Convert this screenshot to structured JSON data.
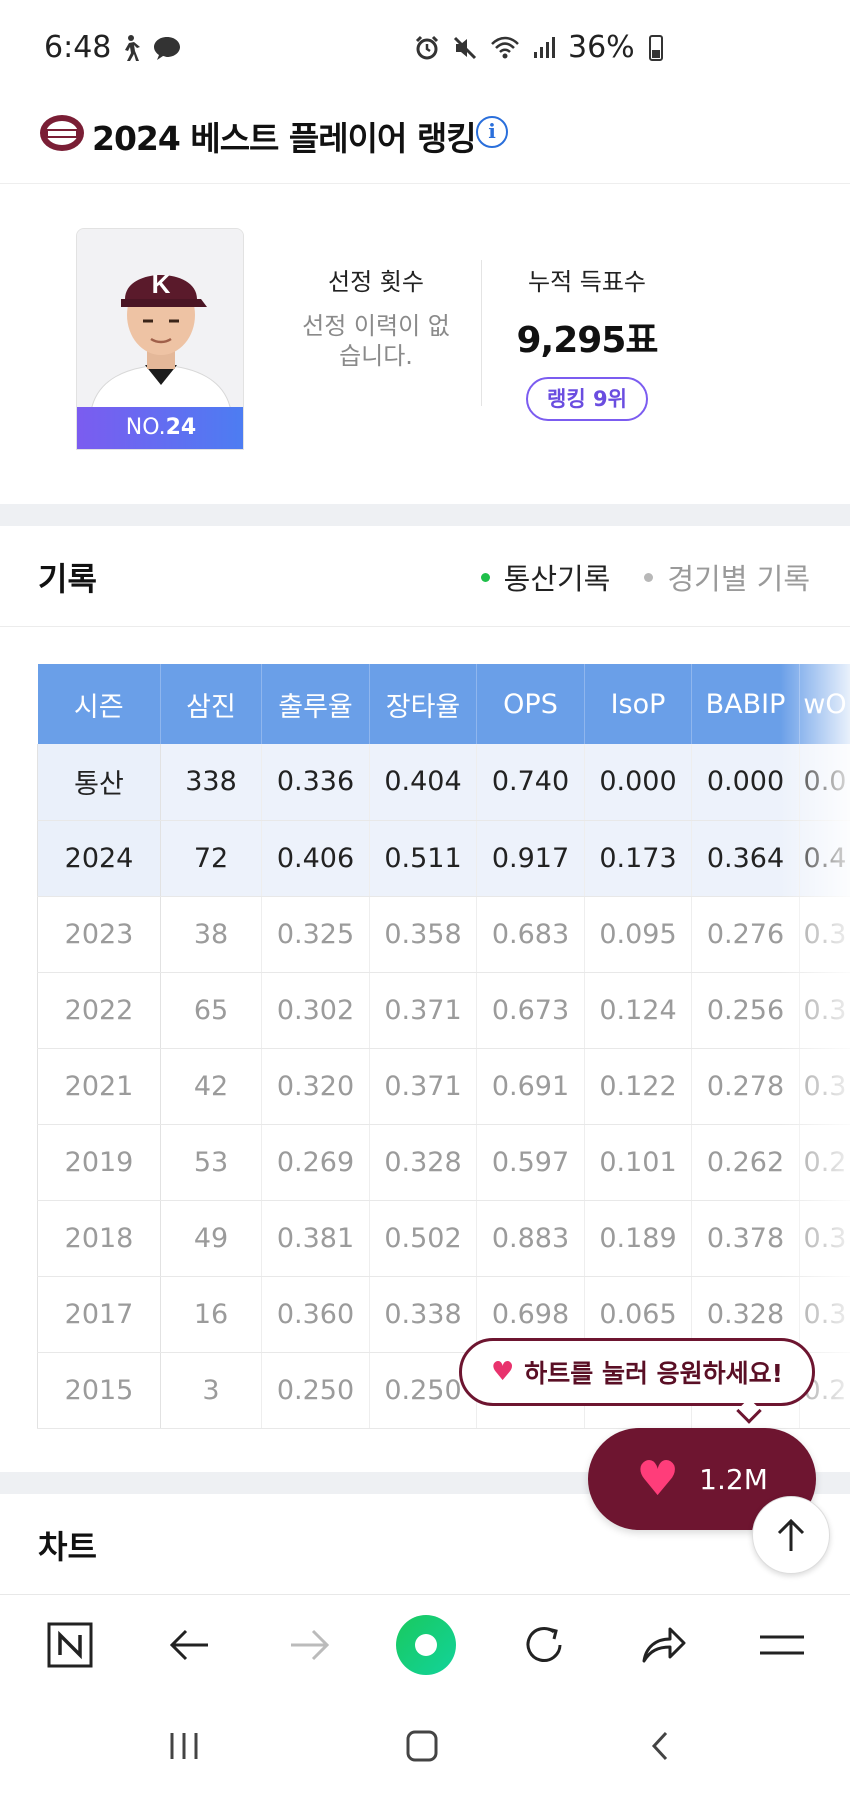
{
  "status_bar": {
    "time": "6:48",
    "battery": "36%"
  },
  "header": {
    "title": "2024 베스트 플레이어 랭킹",
    "info_icon": "info-icon"
  },
  "player": {
    "number_prefix": "NO.",
    "number": "24",
    "selection_label": "선정 횟수",
    "selection_empty": "선정 이력이 없습니다.",
    "votes_label": "누적 득표수",
    "votes": "9,295표",
    "rank": "랭킹 9위"
  },
  "records": {
    "title": "기록",
    "tab_career": "통산기록",
    "tab_by_game": "경기별 기록",
    "columns": [
      "시즌",
      "삼진",
      "출루율",
      "장타율",
      "OPS",
      "IsoP",
      "BABIP",
      "wO"
    ],
    "rows": [
      [
        "통산",
        "338",
        "0.336",
        "0.404",
        "0.740",
        "0.000",
        "0.000",
        "0.0"
      ],
      [
        "2024",
        "72",
        "0.406",
        "0.511",
        "0.917",
        "0.173",
        "0.364",
        "0.4"
      ],
      [
        "2023",
        "38",
        "0.325",
        "0.358",
        "0.683",
        "0.095",
        "0.276",
        "0.3"
      ],
      [
        "2022",
        "65",
        "0.302",
        "0.371",
        "0.673",
        "0.124",
        "0.256",
        "0.3"
      ],
      [
        "2021",
        "42",
        "0.320",
        "0.371",
        "0.691",
        "0.122",
        "0.278",
        "0.3"
      ],
      [
        "2019",
        "53",
        "0.269",
        "0.328",
        "0.597",
        "0.101",
        "0.262",
        "0.2"
      ],
      [
        "2018",
        "49",
        "0.381",
        "0.502",
        "0.883",
        "0.189",
        "0.378",
        "0.3"
      ],
      [
        "2017",
        "16",
        "0.360",
        "0.338",
        "0.698",
        "0.065",
        "0.328",
        "0.3"
      ],
      [
        "2015",
        "3",
        "0.250",
        "0.250",
        "",
        "",
        "",
        "0.2"
      ]
    ]
  },
  "cheer": {
    "bubble_text": "하트를 눌러 응원하세요!",
    "count": "1.2M"
  },
  "chart_section": {
    "title": "차트"
  },
  "colors": {
    "table_header": "#6a9fe8",
    "accent_purple": "#7b5cf0",
    "heart_button": "#6e1530",
    "active_dot": "#1fbf4a"
  }
}
